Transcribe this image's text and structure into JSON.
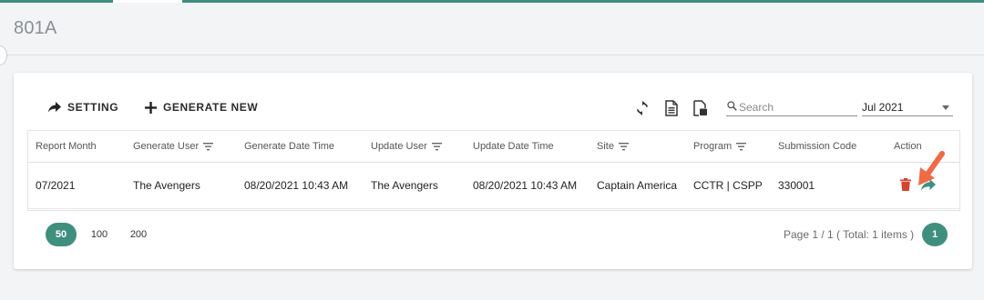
{
  "page": {
    "title": "801A"
  },
  "toolbar": {
    "setting_label": "SETTING",
    "generate_label": "GENERATE NEW",
    "icons": [
      "refresh-icon",
      "csv-export-icon",
      "pdf-export-icon"
    ]
  },
  "search": {
    "placeholder": "Search",
    "value": ""
  },
  "month_select": {
    "value": "Jul 2021"
  },
  "table": {
    "columns": [
      {
        "label": "Report Month",
        "filter": false
      },
      {
        "label": "Generate User",
        "filter": true
      },
      {
        "label": "Generate Date Time",
        "filter": false
      },
      {
        "label": "Update User",
        "filter": true
      },
      {
        "label": "Update Date Time",
        "filter": false
      },
      {
        "label": "Site",
        "filter": true
      },
      {
        "label": "Program",
        "filter": true
      },
      {
        "label": "Submission Code",
        "filter": false
      },
      {
        "label": "Action",
        "filter": false
      }
    ],
    "rows": [
      {
        "report_month": "07/2021",
        "generate_user": "The Avengers",
        "generate_date_time": "08/20/2021 10:43 AM",
        "update_user": "The Avengers",
        "update_date_time": "08/20/2021 10:43 AM",
        "site": "Captain America",
        "program": "CCTR | CSPP",
        "submission_code": "330001"
      }
    ]
  },
  "pagination": {
    "sizes": [
      "50",
      "100",
      "200"
    ],
    "active_size": "50",
    "info": "Page 1 / 1 ( Total: 1 items )",
    "current_page": "1"
  },
  "colors": {
    "accent": "#3f8f7f",
    "delete": "#d9412f",
    "annotation_arrow": "#ef6a45"
  }
}
